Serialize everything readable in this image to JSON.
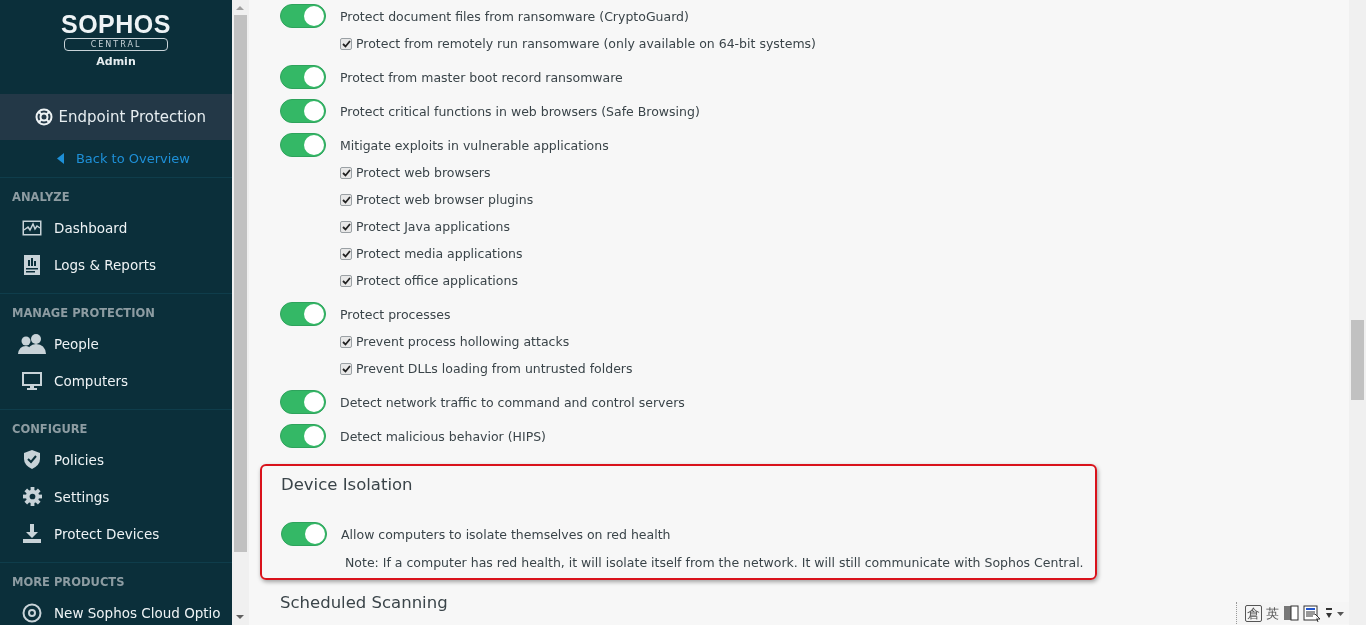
{
  "sidebar": {
    "logo": {
      "brand": "SOPHOS",
      "product": "CENTRAL",
      "role": "Admin"
    },
    "app": {
      "title": "Endpoint Protection"
    },
    "back_link": "Back to Overview",
    "sections": [
      {
        "heading": "ANALYZE",
        "items": [
          {
            "label": "Dashboard",
            "kind": "dashboard"
          },
          {
            "label": "Logs & Reports",
            "kind": "reports"
          }
        ]
      },
      {
        "heading": "MANAGE PROTECTION",
        "items": [
          {
            "label": "People",
            "kind": "people"
          },
          {
            "label": "Computers",
            "kind": "computers"
          }
        ]
      },
      {
        "heading": "CONFIGURE",
        "items": [
          {
            "label": "Policies",
            "kind": "policies"
          },
          {
            "label": "Settings",
            "kind": "settings"
          },
          {
            "label": "Protect Devices",
            "kind": "download"
          }
        ]
      },
      {
        "heading": "MORE PRODUCTS",
        "items": [
          {
            "label": "New Sophos Cloud Optio",
            "kind": "product"
          }
        ]
      }
    ]
  },
  "settings": [
    {
      "kind": "toggle",
      "label": "Protect document files from ransomware (CryptoGuard)",
      "on": true
    },
    {
      "kind": "checkbox",
      "label": "Protect from remotely run ransomware (only available on 64-bit systems)",
      "checked": true
    },
    {
      "kind": "toggle",
      "label": "Protect from master boot record ransomware",
      "on": true
    },
    {
      "kind": "toggle",
      "label": "Protect critical functions in web browsers (Safe Browsing)",
      "on": true
    },
    {
      "kind": "toggle",
      "label": "Mitigate exploits in vulnerable applications",
      "on": true
    },
    {
      "kind": "checkbox",
      "label": "Protect web browsers",
      "checked": true
    },
    {
      "kind": "checkbox",
      "label": "Protect web browser plugins",
      "checked": true
    },
    {
      "kind": "checkbox",
      "label": "Protect Java applications",
      "checked": true
    },
    {
      "kind": "checkbox",
      "label": "Protect media applications",
      "checked": true
    },
    {
      "kind": "checkbox",
      "label": "Protect office applications",
      "checked": true
    },
    {
      "kind": "toggle",
      "label": "Protect processes",
      "on": true
    },
    {
      "kind": "checkbox",
      "label": "Prevent process hollowing attacks",
      "checked": true
    },
    {
      "kind": "checkbox",
      "label": "Prevent DLLs loading from untrusted folders",
      "checked": true
    },
    {
      "kind": "toggle",
      "label": "Detect network traffic to command and control servers",
      "on": true
    },
    {
      "kind": "toggle",
      "label": "Detect malicious behavior (HIPS)",
      "on": true
    }
  ],
  "device_isolation": {
    "heading": "Device Isolation",
    "highlighted": true,
    "setting": {
      "label": "Allow computers to isolate themselves on red health",
      "on": true
    },
    "note": "Note: If a computer has red health, it will isolate itself from the network. It will still communicate with Sophos Central."
  },
  "next_section": {
    "heading": "Scheduled Scanning"
  },
  "ime_toolbar": {
    "keys": [
      "倉",
      "英"
    ]
  }
}
